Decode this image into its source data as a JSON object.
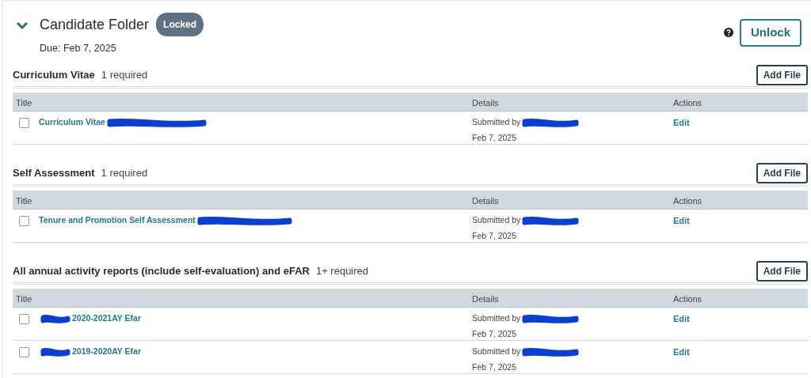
{
  "folder": {
    "title": "Candidate Folder",
    "status_badge": "Locked",
    "due": "Due: Feb 7, 2025",
    "expanded": true,
    "unlock_button": "Unlock"
  },
  "sections": [
    {
      "title": "Curriculum Vitae",
      "requirement": "1 required",
      "add_button": "Add File",
      "columns": [
        "Title",
        "Details",
        "Actions"
      ],
      "rows": [
        {
          "title": "Curriculum Vitae",
          "redaction_before": false,
          "checked": false,
          "submitted": "Submitted by",
          "date": "Feb 7, 2025",
          "action": "Edit"
        }
      ]
    },
    {
      "title": "Self Assessment",
      "requirement": "1 required",
      "add_button": "Add File",
      "columns": [
        "Title",
        "Details",
        "Actions"
      ],
      "rows": [
        {
          "title": "Tenure and Promotion Self Assessment",
          "redaction_before": false,
          "checked": false,
          "submitted": "Submitted by",
          "date": "Feb 7, 2025",
          "action": "Edit"
        }
      ]
    },
    {
      "title": "All annual activity reports (include self-evaluation) and eFAR",
      "requirement": "1+ required",
      "add_button": "Add File",
      "columns": [
        "Title",
        "Details",
        "Actions"
      ],
      "rows": [
        {
          "title": "2020-2021AY Efar",
          "redaction_before": true,
          "checked": false,
          "submitted": "Submitted by",
          "date": "Feb 7, 2025",
          "action": "Edit"
        },
        {
          "title": "2019-2020AY Efar",
          "redaction_before": true,
          "checked": false,
          "submitted": "Submitted by",
          "date": "Feb 7, 2025",
          "action": "Edit"
        }
      ]
    }
  ]
}
